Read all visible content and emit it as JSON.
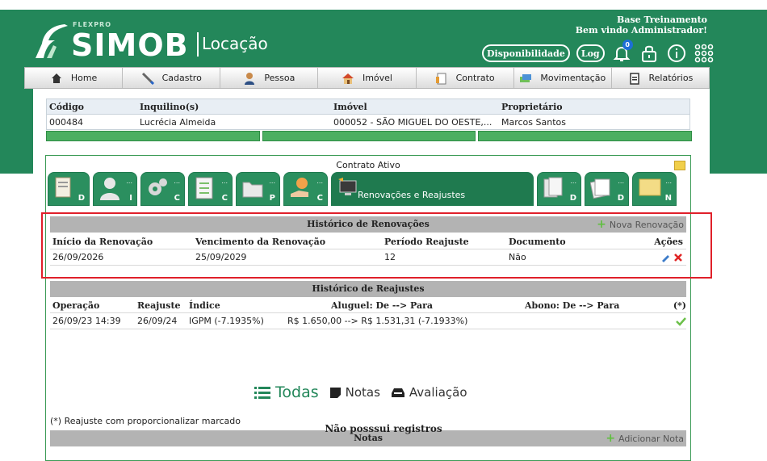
{
  "brand": {
    "flexpro": "FLEXPRO",
    "name": "SIMOB",
    "module": "Locação"
  },
  "user": {
    "company": "Base Treinamento",
    "greeting": "Bem vindo Administrador!"
  },
  "tools": {
    "availability_label": "Disponibilidade",
    "log_label": "Log",
    "notifications_count": "0"
  },
  "nav": {
    "items": [
      {
        "label": "Home",
        "icon": "home-icon"
      },
      {
        "label": "Cadastro",
        "icon": "pencil-icon"
      },
      {
        "label": "Pessoa",
        "icon": "person-icon"
      },
      {
        "label": "Imóvel",
        "icon": "house-icon"
      },
      {
        "label": "Contrato",
        "icon": "contract-icon"
      },
      {
        "label": "Movimentação",
        "icon": "money-icon"
      },
      {
        "label": "Relatórios",
        "icon": "report-icon"
      }
    ]
  },
  "contract": {
    "headers": [
      "Código",
      "Inquilino(s)",
      "Imóvel",
      "Proprietário"
    ],
    "row": [
      "000484",
      "Lucrécia Almeida",
      "000052 - SÃO MIGUEL DO OESTE,...",
      "Marcos Santos"
    ]
  },
  "status_title": "Contrato Ativo",
  "tabs": [
    {
      "letter": "D",
      "dots": "..."
    },
    {
      "letter": "I",
      "dots": "..."
    },
    {
      "letter": "C",
      "dots": "..."
    },
    {
      "letter": "C",
      "dots": "..."
    },
    {
      "letter": "P",
      "dots": "..."
    },
    {
      "letter": "C",
      "dots": "..."
    },
    {
      "label": "Renovações e Reajustes"
    },
    {
      "letter": "D",
      "dots": "..."
    },
    {
      "letter": "D",
      "dots": "..."
    },
    {
      "letter": "N",
      "dots": "..."
    }
  ],
  "renovacoes": {
    "title": "Histórico de Renovações",
    "action": "Nova Renovação",
    "headers": [
      "Início da Renovação",
      "Vencimento da Renovação",
      "Período Reajuste",
      "Documento",
      "Ações"
    ],
    "rows": [
      [
        "26/09/2026",
        "25/09/2029",
        "12",
        "Não"
      ]
    ]
  },
  "reajustes": {
    "title": "Histórico de Reajustes",
    "headers": [
      "Operação",
      "Reajuste",
      "Índice",
      "Aluguel: De --> Para",
      "Abono: De --> Para",
      "(*)"
    ],
    "rows": [
      [
        "26/09/23 14:39",
        "26/09/24",
        "IGPM (-7.1935%)",
        "R$ 1.650,00 --> R$ 1.531,31 (-7.1933%)",
        ""
      ]
    ]
  },
  "footnote": "(*) Reajuste com proporcionalizar marcado",
  "notas": {
    "title": "Notas",
    "action": "Adicionar Nota",
    "filters": [
      "Todas",
      "Notas",
      "Avaliação"
    ],
    "empty": "Não posssui registros"
  },
  "colors": {
    "header_green": "#23875a",
    "highlight_red": "#e0202a",
    "bar_green": "#4caf61"
  }
}
